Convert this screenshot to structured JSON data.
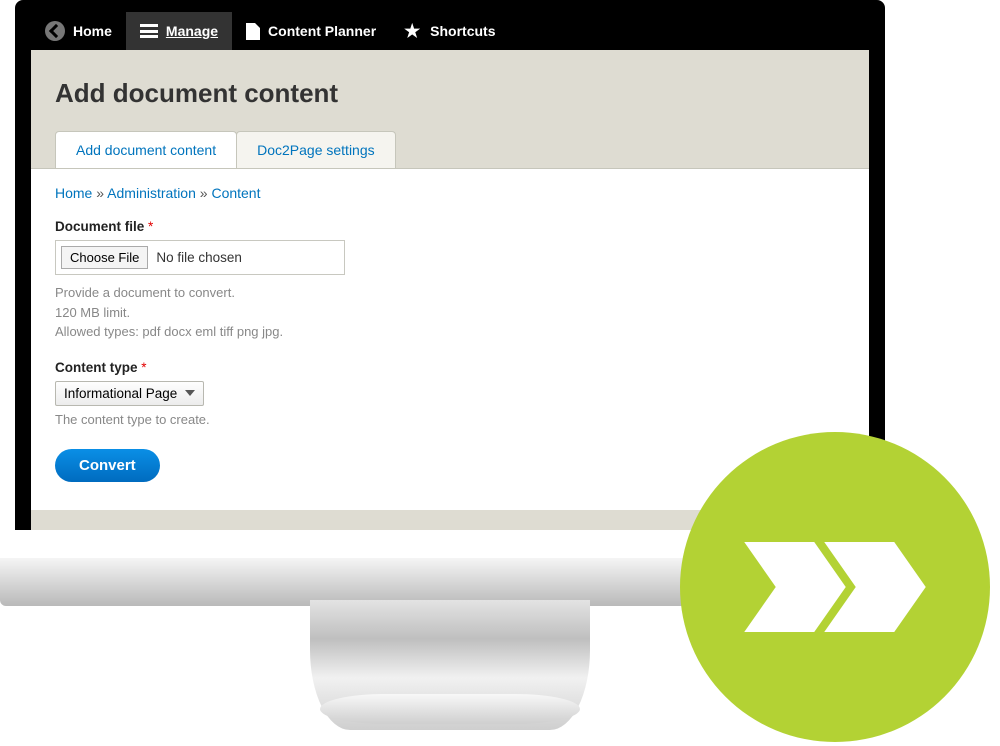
{
  "topbar": {
    "home": "Home",
    "manage": "Manage",
    "content_planner": "Content Planner",
    "shortcuts": "Shortcuts"
  },
  "page_title": "Add document content",
  "tabs": {
    "add": "Add document content",
    "settings": "Doc2Page settings"
  },
  "breadcrumb": {
    "home": "Home",
    "admin": "Administration",
    "content": "Content",
    "sep": "»"
  },
  "document_file": {
    "label": "Document file",
    "choose": "Choose File",
    "status": "No file chosen",
    "help1": "Provide a document to convert.",
    "help2": "120 MB limit.",
    "help3": "Allowed types: pdf docx eml tiff png jpg."
  },
  "content_type": {
    "label": "Content type",
    "value": "Informational Page",
    "help": "The content type to create."
  },
  "convert": "Convert",
  "required_marker": "*"
}
